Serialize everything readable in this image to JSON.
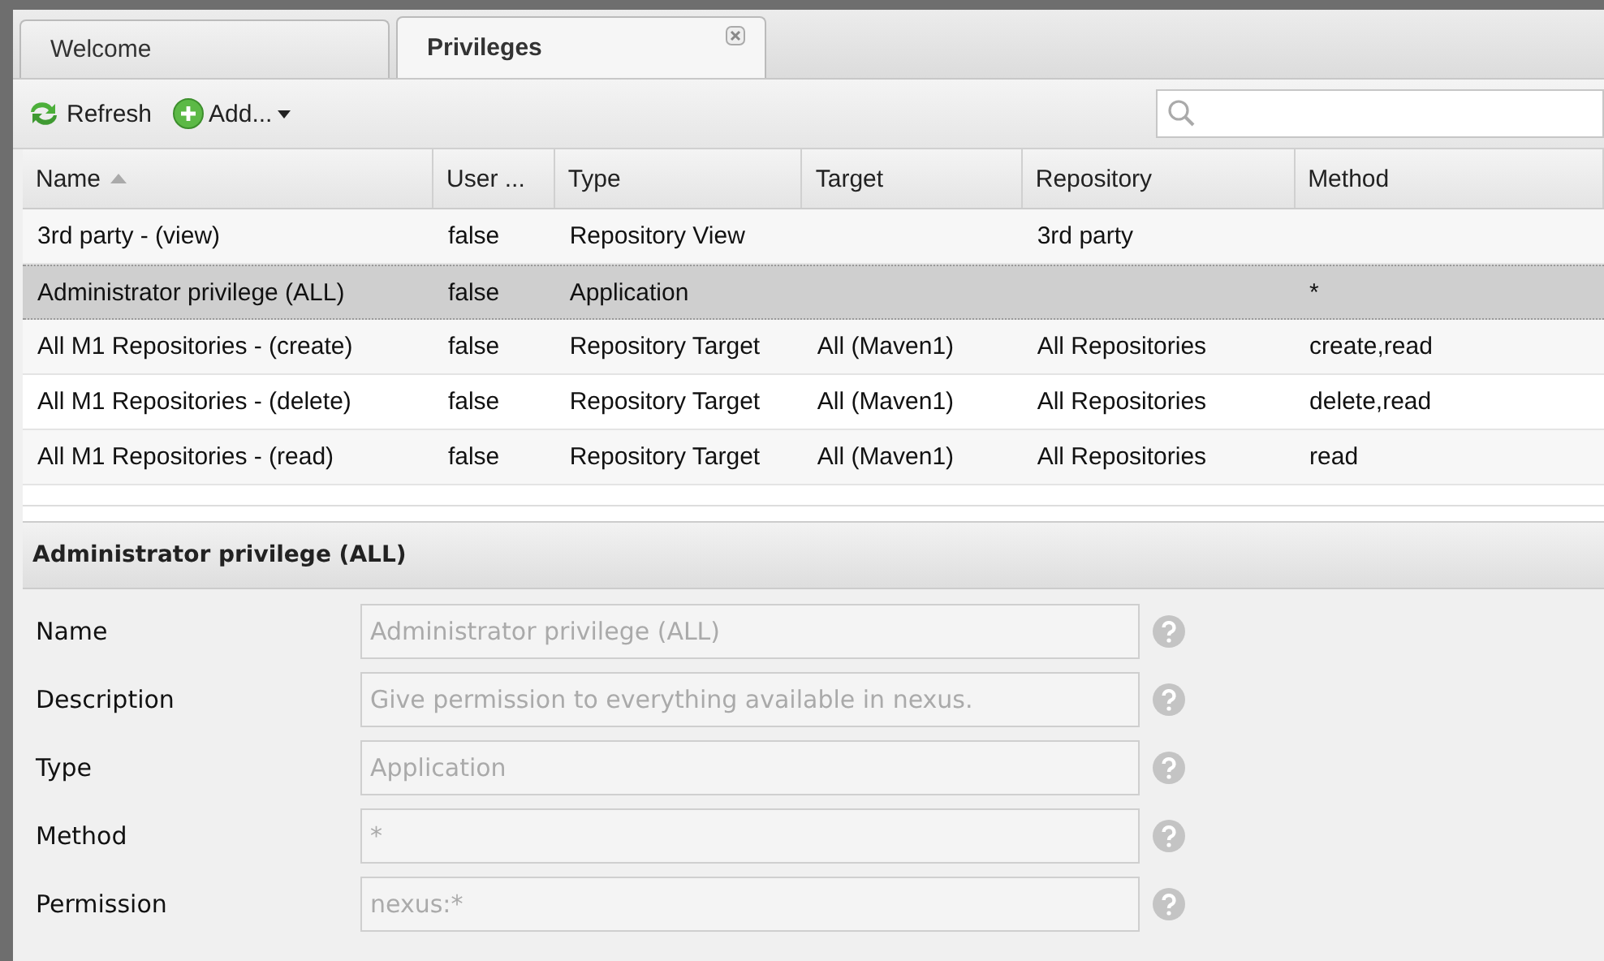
{
  "tabs": [
    {
      "label": "Welcome",
      "selected": false,
      "closable": false
    },
    {
      "label": "Privileges",
      "selected": true,
      "closable": true
    }
  ],
  "toolbar": {
    "buttons": [
      {
        "label": "Refresh",
        "kind": "refresh"
      },
      {
        "label": "Add...",
        "kind": "add"
      }
    ],
    "search": {
      "shown": true
    }
  },
  "table": {
    "columns": [
      {
        "label": "Name",
        "sorted": true
      },
      {
        "label": "User ...",
        "sorted": false
      },
      {
        "label": "Type",
        "sorted": false
      },
      {
        "label": "Target",
        "sorted": false
      },
      {
        "label": "Repository",
        "sorted": false
      },
      {
        "label": "Method",
        "sorted": false
      }
    ],
    "rows": [
      {
        "cells": [
          "3rd party - (view)",
          "false",
          "Repository View",
          "",
          "3rd party",
          ""
        ],
        "selected": false
      },
      {
        "cells": [
          "Administrator privilege (ALL)",
          "false",
          "Application",
          "",
          "",
          "*"
        ],
        "selected": true
      },
      {
        "cells": [
          "All M1 Repositories - (create)",
          "false",
          "Repository Target",
          "All (Maven1)",
          "All Repositories",
          "create,read"
        ],
        "selected": false
      },
      {
        "cells": [
          "All M1 Repositories - (delete)",
          "false",
          "Repository Target",
          "All (Maven1)",
          "All Repositories",
          "delete,read"
        ],
        "selected": false
      },
      {
        "cells": [
          "All M1 Repositories - (read)",
          "false",
          "Repository Target",
          "All (Maven1)",
          "All Repositories",
          "read"
        ],
        "selected": false
      }
    ]
  },
  "detail": {
    "title": "Administrator privilege (ALL)",
    "fields": [
      {
        "label": "Name",
        "value": "Administrator privilege (ALL)",
        "disabled": true
      },
      {
        "label": "Description",
        "value": "Give permission to everything available in nexus.",
        "disabled": true
      },
      {
        "label": "Type",
        "value": "Application",
        "disabled": true
      },
      {
        "label": "Method",
        "value": "*",
        "disabled": true
      },
      {
        "label": "Permission",
        "value": "nexus:*",
        "disabled": true
      }
    ]
  }
}
